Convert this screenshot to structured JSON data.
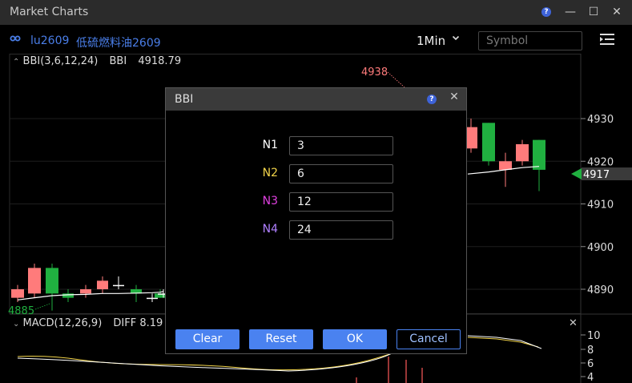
{
  "window": {
    "title": "Market Charts",
    "help_glyph": "?",
    "minimize_glyph": "—",
    "maximize_glyph": "☐",
    "close_glyph": "✕"
  },
  "toolbar": {
    "symbol_code": "lu2609",
    "symbol_name": "低硫燃料油2609",
    "interval": "1Min",
    "symbol_placeholder": "Symbol"
  },
  "main_panel": {
    "indicator_label": "BBI(3,6,12,24)",
    "value_name": "BBI",
    "value": "4918.79",
    "high_marker": "4938",
    "low_marker": "4885",
    "current_price": "4917",
    "price_ticks": [
      "4930",
      "4920",
      "4910",
      "4900",
      "4890"
    ],
    "colors": {
      "up": "#ff7b7b",
      "down": "#20b040",
      "bbi_line": "#ffffff",
      "marker_low": "#20b040",
      "marker_high": "#ff7b7b"
    }
  },
  "macd_panel": {
    "indicator_label": "MACD(12,26,9)",
    "diff_label": "DIFF 8.19",
    "ticks": [
      "10",
      "8",
      "6",
      "4"
    ],
    "close_glyph": "✕"
  },
  "dialog": {
    "title": "BBI",
    "help_glyph": "?",
    "close_glyph": "✕",
    "params": [
      {
        "label": "N1",
        "value": "3",
        "color": "#ffffff"
      },
      {
        "label": "N2",
        "value": "6",
        "color": "#f2d44a"
      },
      {
        "label": "N3",
        "value": "12",
        "color": "#e040e0"
      },
      {
        "label": "N4",
        "value": "24",
        "color": "#b080ff"
      }
    ],
    "buttons": {
      "clear": "Clear",
      "reset": "Reset",
      "ok": "OK",
      "cancel": "Cancel"
    }
  },
  "chart_data": {
    "type": "candlestick",
    "title": "lu2609 低硫燃料油2609",
    "interval": "1Min",
    "ylim": [
      4880,
      4940
    ],
    "left_candles": [
      {
        "open": 4888,
        "close": 4890,
        "high": 4891,
        "low": 4887
      },
      {
        "open": 4889,
        "close": 4895,
        "high": 4896,
        "low": 4888
      },
      {
        "open": 4895,
        "close": 4889,
        "high": 4896,
        "low": 4885
      },
      {
        "open": 4889,
        "close": 4888,
        "high": 4890,
        "low": 4887
      },
      {
        "open": 4889,
        "close": 4890,
        "high": 4891,
        "low": 4888
      },
      {
        "open": 4890,
        "close": 4892,
        "high": 4893,
        "low": 4889
      },
      {
        "open": 4891,
        "close": 4891,
        "high": 4893,
        "low": 4890
      },
      {
        "open": 4890,
        "close": 4889,
        "high": 4891,
        "low": 4887
      },
      {
        "open": 4888,
        "close": 4888,
        "high": 4889,
        "low": 4887
      },
      {
        "open": 4889,
        "close": 4888,
        "high": 4890,
        "low": 4888
      },
      {
        "open": 4889,
        "close": 4889,
        "high": 4890,
        "low": 4888
      }
    ],
    "right_candles": [
      {
        "open": 4923,
        "close": 4928,
        "high": 4930,
        "low": 4922
      },
      {
        "open": 4929,
        "close": 4920,
        "high": 4929,
        "low": 4919
      },
      {
        "open": 4918,
        "close": 4920,
        "high": 4922,
        "low": 4914
      },
      {
        "open": 4920,
        "close": 4924,
        "high": 4925,
        "low": 4919
      },
      {
        "open": 4925,
        "close": 4918,
        "high": 4925,
        "low": 4913
      }
    ]
  }
}
